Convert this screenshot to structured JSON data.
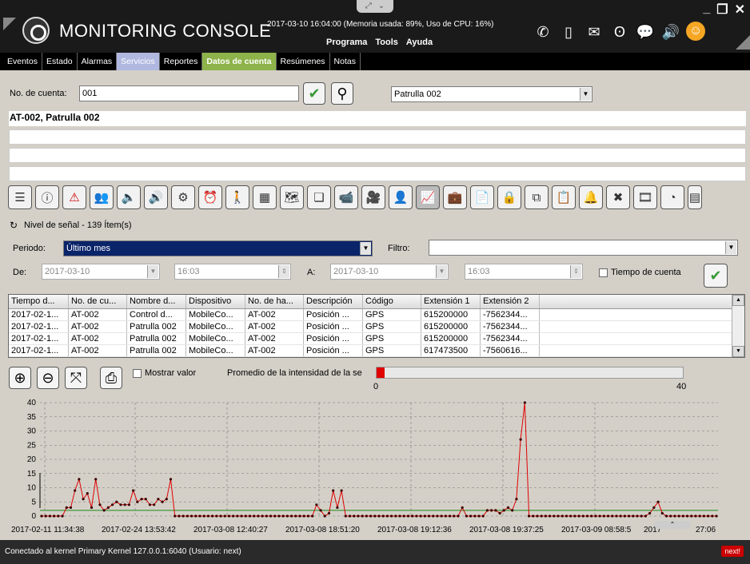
{
  "header": {
    "app_title": "MONITORING CONSOLE",
    "status": "2017-03-10 16:04:00 (Memoria usada: 89%, Uso de CPU: 16%)",
    "menu": [
      "Programa",
      "Tools",
      "Ayuda"
    ],
    "icons": [
      "phone-icon",
      "sms-icon",
      "mail-icon",
      "owl-icon",
      "chat-icon",
      "speaker-icon",
      "smiley-icon"
    ]
  },
  "tabs": [
    "Eventos",
    "Estado",
    "Alarmas",
    "Servicios",
    "Reportes",
    "Datos de cuenta",
    "Resúmenes",
    "Notas"
  ],
  "account": {
    "label": "No. de cuenta:",
    "value": "001",
    "patrol": "Patrulla 002",
    "name_line": "AT-002, Patrulla 002"
  },
  "toolbar_icons": [
    "notes-icon",
    "info-icon",
    "warning-icon",
    "users-icon",
    "speaker-icon",
    "alarm-speaker-icon",
    "gears-icon",
    "clock-icon",
    "walking-person-icon",
    "floorplan-icon",
    "map-icon",
    "layers-icon",
    "video-camera-icon",
    "multi-camera-icon",
    "person-camera-icon",
    "signal-chart-icon",
    "briefcase-icon",
    "document-search-icon",
    "lock-icon",
    "copy-docs-icon",
    "clipboard-icon",
    "bell-operator-icon",
    "tools-icon",
    "film-icon",
    "dashboard-icon",
    "pages-icon"
  ],
  "signal": {
    "title": "Nivel de señal - 139 Ítem(s)"
  },
  "filters": {
    "period_label": "Periodo:",
    "period_value": "Último mes",
    "filter_label": "Filtro:",
    "from_label": "De:",
    "from_date": "2017-03-10",
    "from_time": "16:03",
    "to_label": "A:",
    "to_date": "2017-03-10",
    "to_time": "16:03",
    "account_time_label": "Tiempo de cuenta"
  },
  "table": {
    "columns": [
      "Tiempo d...",
      "No. de cu...",
      "Nombre d...",
      "Dispositivo",
      "No. de ha...",
      "Descripción",
      "Código",
      "Extensión 1",
      "Extensión 2"
    ],
    "rows": [
      [
        "2017-02-1...",
        "AT-002",
        "Control d...",
        "MobileCo...",
        "AT-002",
        "Posición ...",
        "GPS",
        "615200000",
        "-7562344..."
      ],
      [
        "2017-02-1...",
        "AT-002",
        "Patrulla 002",
        "MobileCo...",
        "AT-002",
        "Posición ...",
        "GPS",
        "615200000",
        "-7562344..."
      ],
      [
        "2017-02-1...",
        "AT-002",
        "Patrulla 002",
        "MobileCo...",
        "AT-002",
        "Posición ...",
        "GPS",
        "615200000",
        "-7562344..."
      ],
      [
        "2017-02-1...",
        "AT-002",
        "Patrulla 002",
        "MobileCo...",
        "AT-002",
        "Posición ...",
        "GPS",
        "617473500",
        "-7560616..."
      ]
    ]
  },
  "chart_controls": {
    "show_value_label": "Mostrar valor",
    "avg_label": "Promedio de la intensidad de la se",
    "avg_value": 1,
    "avg_min": "0",
    "avg_max": "40"
  },
  "chart_data": {
    "type": "line",
    "ylim": [
      0,
      40
    ],
    "yticks": [
      "0",
      "5",
      "10",
      "15",
      "20",
      "25",
      "30",
      "35",
      "40"
    ],
    "xticks": [
      "2017-02-11 11:34:38",
      "2017-02-24 13:53:42",
      "2017-03-08 12:40:27",
      "2017-03-08 18:51:20",
      "2017-03-08 19:12:36",
      "2017-03-08 19:37:25",
      "2017-03-09 08:58:5",
      "2017",
      "27:06"
    ],
    "average": 2,
    "series": [
      {
        "color": "#e00000",
        "values": [
          0,
          0,
          0,
          0,
          0,
          0,
          3,
          3,
          9,
          13,
          6,
          8,
          3,
          13,
          4,
          2,
          3,
          4,
          5,
          4,
          4,
          4,
          9,
          5,
          6,
          6,
          4,
          4,
          6,
          5,
          6,
          13,
          0,
          0,
          0,
          0,
          0,
          0,
          0,
          0,
          0,
          0,
          0,
          0,
          0,
          0,
          0,
          0,
          0,
          0,
          0,
          0,
          0,
          0,
          0,
          0,
          0,
          0,
          0,
          0,
          0,
          0,
          0,
          0,
          0,
          0,
          4,
          2,
          0,
          1,
          9,
          3,
          9,
          0,
          0,
          0,
          0,
          0,
          0,
          0,
          0,
          0,
          0,
          0,
          0,
          0,
          0,
          0,
          0,
          0,
          0,
          0,
          0,
          0,
          0,
          0,
          0,
          0,
          0,
          0,
          0,
          3,
          0,
          0,
          0,
          0,
          0,
          2,
          2,
          2,
          1,
          2,
          3,
          2,
          6,
          27,
          40,
          0,
          0,
          0,
          0,
          0,
          0,
          0,
          0,
          0,
          0,
          0,
          0,
          0,
          0,
          0,
          0,
          0,
          0,
          0,
          0,
          0,
          0,
          0,
          0,
          0,
          0,
          0,
          0,
          0,
          1,
          3,
          5,
          1,
          0,
          0,
          0,
          0,
          0,
          0,
          0,
          0,
          0,
          0,
          0,
          0,
          0
        ]
      }
    ]
  },
  "status_bar": {
    "text": "Conectado al kernel Primary Kernel 127.0.0.1:6040 (Usuario: next)",
    "user": "next!"
  }
}
